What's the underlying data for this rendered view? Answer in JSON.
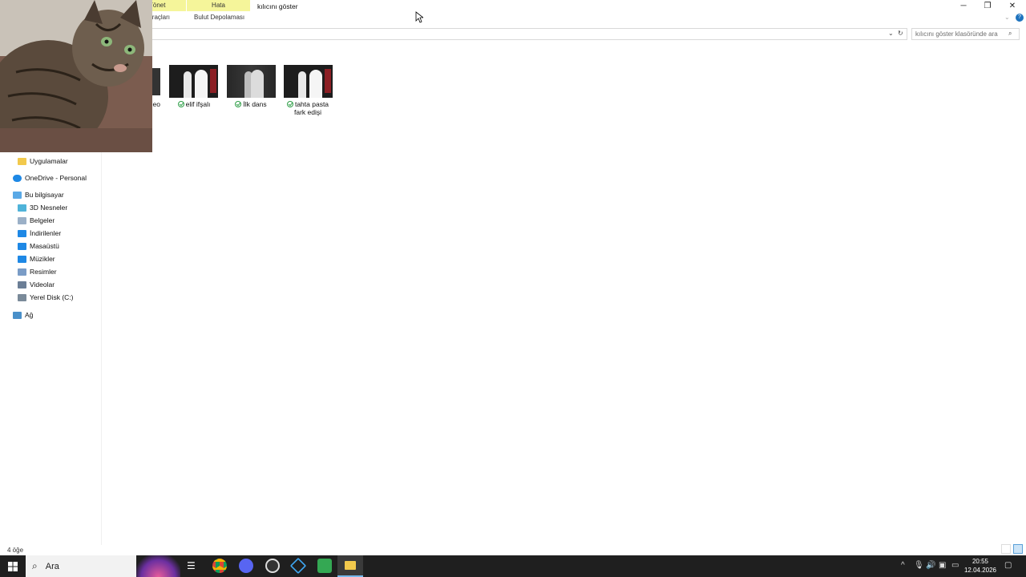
{
  "window": {
    "title": "kılıcını göster",
    "ribbon_context_tabs": [
      "Yönet",
      "Hata"
    ],
    "ribbon_subtabs": [
      "Resim Araçları",
      "Bulut Depolaması"
    ],
    "controls": {
      "minimize": "─",
      "restore": "❐",
      "close": "✕"
    }
  },
  "search": {
    "placeholder": "kılıcını göster klasöründe ara"
  },
  "files": [
    {
      "name": "video",
      "partial_caption": "eo"
    },
    {
      "name": "elif ifşalı"
    },
    {
      "name": "İlk dans"
    },
    {
      "name": "tahta pasta",
      "line2": "fark edişi"
    }
  ],
  "nav": {
    "items": [
      {
        "label": "Uygulamalar",
        "icon": "folder-icon",
        "color": "#f2c94c"
      },
      {
        "label": "OneDrive - Personal",
        "icon": "onedrive-icon",
        "color": "#1e88e5"
      },
      {
        "label": "Bu bilgisayar",
        "icon": "computer-icon",
        "color": "#5aa9e6"
      },
      {
        "label": "3D Nesneler",
        "icon": "3d-objects-icon",
        "color": "#4fb3d9"
      },
      {
        "label": "Belgeler",
        "icon": "documents-icon",
        "color": "#9bb0c7"
      },
      {
        "label": "İndirilenler",
        "icon": "downloads-icon",
        "color": "#1e88e5"
      },
      {
        "label": "Masaüstü",
        "icon": "desktop-icon",
        "color": "#1e88e5"
      },
      {
        "label": "Müzikler",
        "icon": "music-icon",
        "color": "#1e88e5"
      },
      {
        "label": "Resimler",
        "icon": "pictures-icon",
        "color": "#7a9cc6"
      },
      {
        "label": "Videolar",
        "icon": "videos-icon",
        "color": "#6b7e96"
      },
      {
        "label": "Yerel Disk (C:)",
        "icon": "disk-icon",
        "color": "#7a8a99"
      },
      {
        "label": "Ağ",
        "icon": "network-icon",
        "color": "#4a90c9"
      }
    ]
  },
  "status": {
    "count": "4 öğe"
  },
  "taskbar": {
    "search_label": "Ara",
    "time": "20:55",
    "date": "12.04.2026"
  }
}
